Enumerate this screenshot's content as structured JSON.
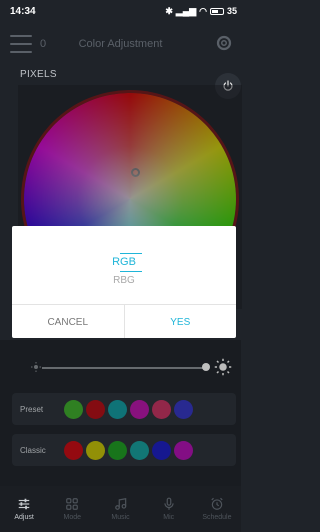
{
  "status_bar": {
    "time": "14:34",
    "battery": "35"
  },
  "header": {
    "zone_count": "0",
    "title": "Color Adjustment"
  },
  "pixels_label": "PIXELS",
  "dialog": {
    "options": [
      "RGB",
      "RBG"
    ],
    "selected": "RGB",
    "cancel_label": "CANCEL",
    "confirm_label": "YES"
  },
  "brightness_level": 1.0,
  "preset": {
    "label": "Preset",
    "colors": [
      "#3a9d2a",
      "#a10f16",
      "#138d92",
      "#a6159a",
      "#b2305a",
      "#3132b0"
    ]
  },
  "classic": {
    "label": "Classic",
    "colors": [
      "#b50d14",
      "#b3b009",
      "#1e8f22",
      "#17908f",
      "#1b1eb0",
      "#a012a2"
    ]
  },
  "tabs": [
    {
      "label": "Adjust",
      "icon": "sliders-icon",
      "active": true
    },
    {
      "label": "Mode",
      "icon": "grid-icon",
      "active": false
    },
    {
      "label": "Music",
      "icon": "music-note-icon",
      "active": false
    },
    {
      "label": "Mic",
      "icon": "microphone-icon",
      "active": false
    },
    {
      "label": "Schedule",
      "icon": "alarm-clock-icon",
      "active": false
    }
  ],
  "colors": {
    "accent": "#1fb5d8",
    "background": "#1f2329",
    "panel": "#2a2f36",
    "wheel_ring": "#8c1414"
  }
}
